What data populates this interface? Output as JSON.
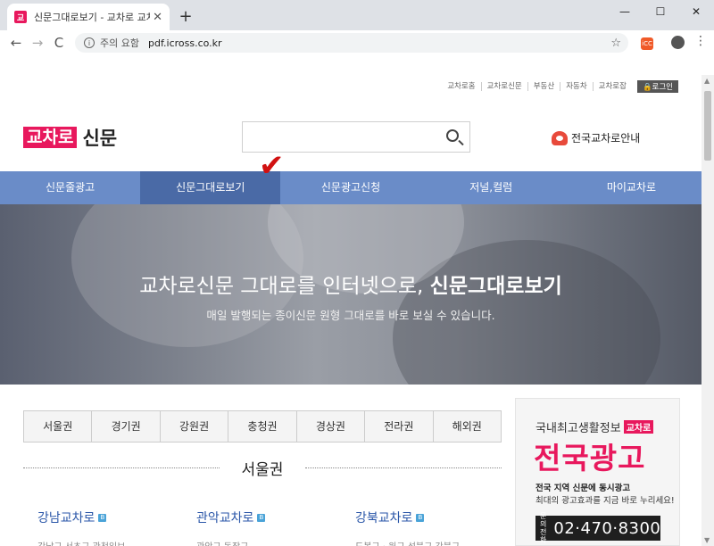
{
  "browser": {
    "tab_title": "신문그대로보기 - 교차로 교차로신문",
    "tab_favicon": "교",
    "new_tab": "+",
    "close": "✕",
    "minimize": "—",
    "maximize": "☐",
    "back": "←",
    "forward": "→",
    "reload": "C",
    "security_label": "주의 요함",
    "url": "pdf.icross.co.kr",
    "star": "☆",
    "ext1": "iCC",
    "ext2": "",
    "menu": "⋮",
    "info_glyph": "i"
  },
  "util_links": [
    "교차로홈",
    "교차로신문",
    "부동산",
    "자동차",
    "교차로잡"
  ],
  "login_label": "로그인",
  "logo": {
    "box": "교차로",
    "text": "신문"
  },
  "guide_label": "전국교차로안내",
  "gnb": [
    "신문줄광고",
    "신문그대로보기",
    "신문광고신청",
    "저널,컬럼",
    "마이교차로"
  ],
  "checkmark": "✔",
  "hero": {
    "title_plain": "교차로신문 그대로를 인터넷으로, ",
    "title_bold": "신문그대로보기",
    "subtitle": "매일 발행되는 종이신문 원형 그대로를 바로 보실 수 있습니다."
  },
  "region_tabs": [
    "서울권",
    "경기권",
    "강원권",
    "충청권",
    "경상권",
    "전라권",
    "해외권"
  ],
  "region_heading": "서울권",
  "outlets": [
    {
      "name": "강남교차로",
      "badge": "B",
      "sub": "강남구 서초구 관천일보"
    },
    {
      "name": "관악교차로",
      "badge": "B",
      "sub": "관악구 동작구"
    },
    {
      "name": "강북교차로",
      "badge": "B",
      "sub": "도봉구 · 원구 성북구 강북구"
    }
  ],
  "ad": {
    "top": "국내최고생활정보",
    "badge": "교차로",
    "big": "전국광고",
    "line1": "전국 지역 신문에 동시광고",
    "line2": "최대의 광고효과를 지금 바로 누리세요!",
    "phone_label": "문의 전화",
    "phone": "02·470·8300"
  },
  "colors": {
    "brand": "#e8185d",
    "gnb": "#6a8cc8",
    "gnb_active": "#4a6aa6",
    "link": "#2a56a8"
  }
}
